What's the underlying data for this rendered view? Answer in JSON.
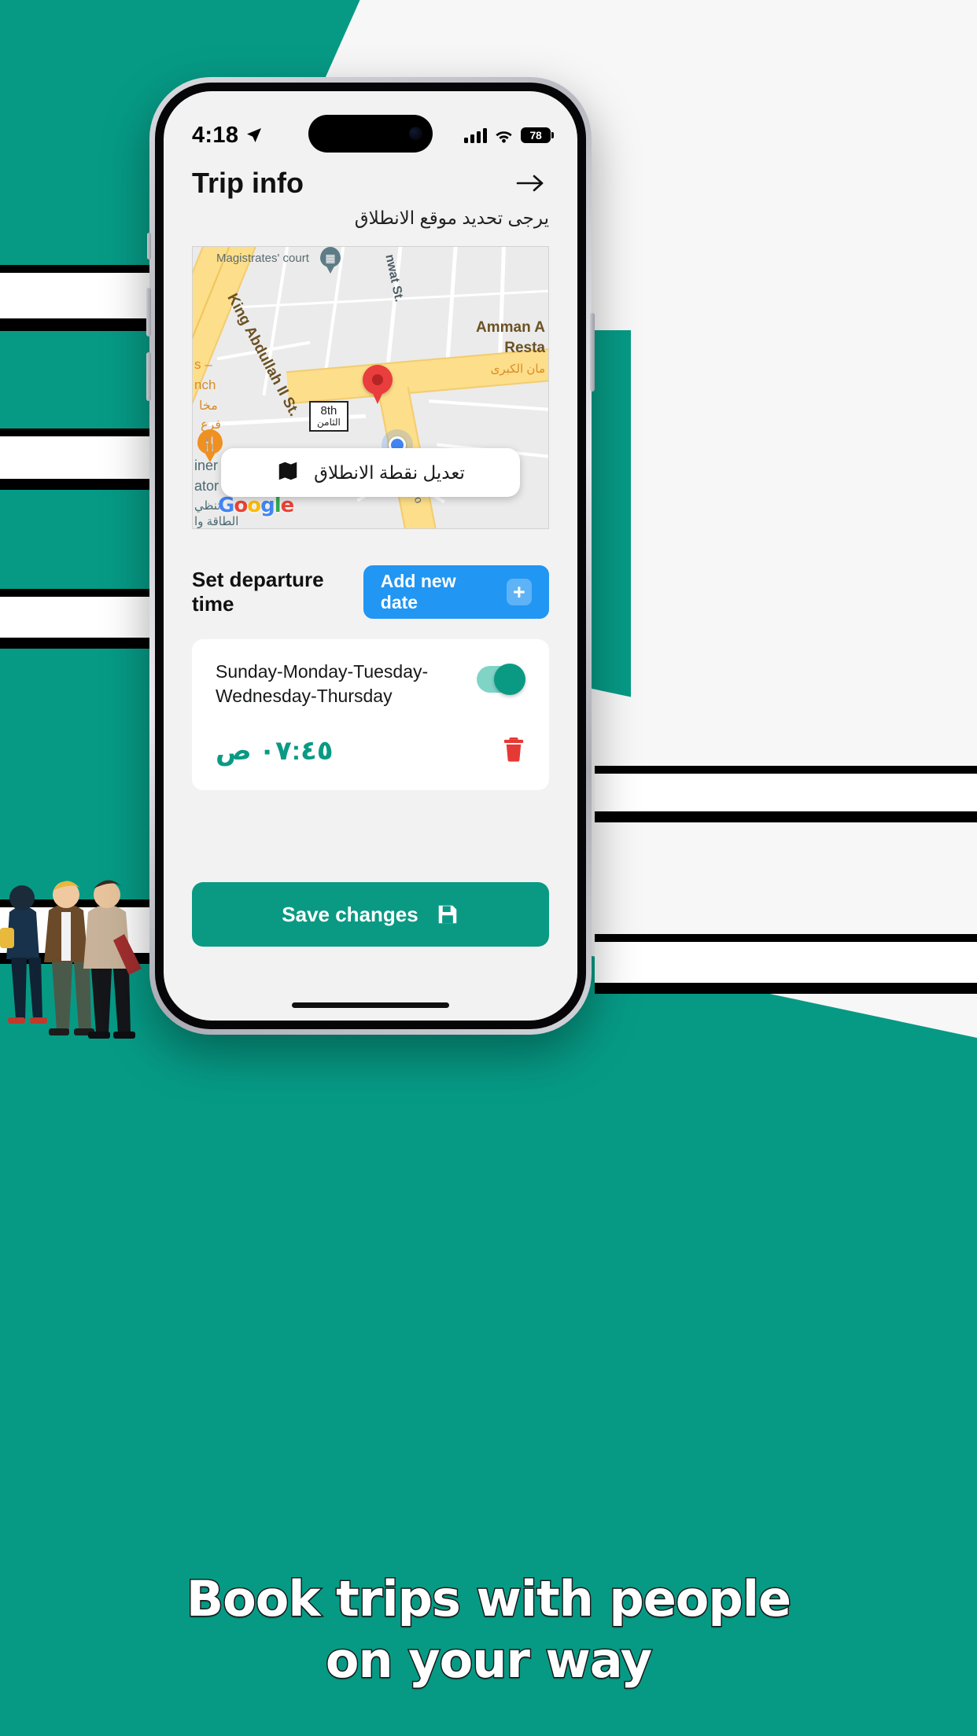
{
  "statusbar": {
    "time": "4:18",
    "location_icon": "location-arrow-icon",
    "signal_icon": "cellular-bars-icon",
    "wifi_icon": "wifi-icon",
    "battery_level": "78"
  },
  "header": {
    "title": "Trip info",
    "forward_icon": "arrow-right-icon",
    "subtitle": "يرجى تحديد موقع الانطلاق"
  },
  "map": {
    "labels": {
      "magistrates_court": "Magistrates' court",
      "king_abdullah": "King Abdullah II St.",
      "nwat_st": "nwat St.",
      "amman_a": "Amman A",
      "resta": "Resta",
      "arabic_kubra": "مان الكبرى",
      "s_dash": "s –",
      "nch": "nch",
      "mkha": "مخا",
      "fara": "فرع",
      "iner": "iner",
      "ator": "ator",
      "tanzim": "تنظي",
      "taqa": "الطاقة وا",
      "amro": "mro",
      "shield_number": "8th",
      "shield_arabic": "الثامن"
    },
    "google_logo": "Google",
    "marker_icon": "red-location-pin",
    "user_dot_icon": "blue-user-location-dot",
    "court_pin_icon": "courthouse-pin-icon",
    "restaurant_pin_icon": "restaurant-pin-icon",
    "edit_start_button": {
      "label": "تعديل نقطة الانطلاق",
      "icon": "map-icon"
    }
  },
  "departure": {
    "section_title": "Set departure time",
    "add_button": {
      "label": "Add new date",
      "icon": "plus-icon"
    },
    "schedule": {
      "days": "Sunday-Monday-Tuesday-Wednesday-Thursday",
      "time": "٠٧:٤٥ ص",
      "enabled": true,
      "delete_icon": "trash-icon",
      "toggle_icon": "toggle-switch-on"
    }
  },
  "footer": {
    "save_button": {
      "label": "Save changes",
      "icon": "save-disk-icon"
    }
  },
  "promo": {
    "line1": "Book trips with people",
    "line2": "on your way"
  },
  "colors": {
    "brand_teal": "#069a85",
    "accent_blue": "#2196f3",
    "delete_red": "#e53935",
    "marker_red": "#ea3d3d"
  }
}
